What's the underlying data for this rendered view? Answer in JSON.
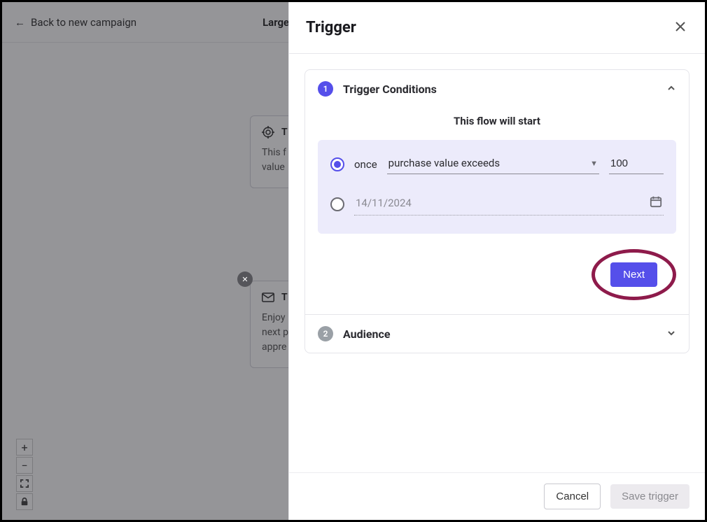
{
  "header": {
    "back_label": "Back to new campaign",
    "center_title": "Large o"
  },
  "bg_cards": {
    "card1": {
      "title": "T",
      "line1": "This f",
      "line2": "value"
    },
    "card2": {
      "title": "T",
      "line1": "Enjoy",
      "line2": "next p",
      "line3": "appre"
    }
  },
  "panel": {
    "title": "Trigger",
    "step1_number": "1",
    "step1_title": "Trigger Conditions",
    "flow_start_label": "This flow will start",
    "option_once_label": "once",
    "condition_select_value": "purchase value exceeds",
    "condition_value": "100",
    "date_placeholder": "14/11/2024",
    "next_label": "Next",
    "step2_number": "2",
    "step2_title": "Audience"
  },
  "footer": {
    "cancel_label": "Cancel",
    "save_label": "Save trigger"
  }
}
